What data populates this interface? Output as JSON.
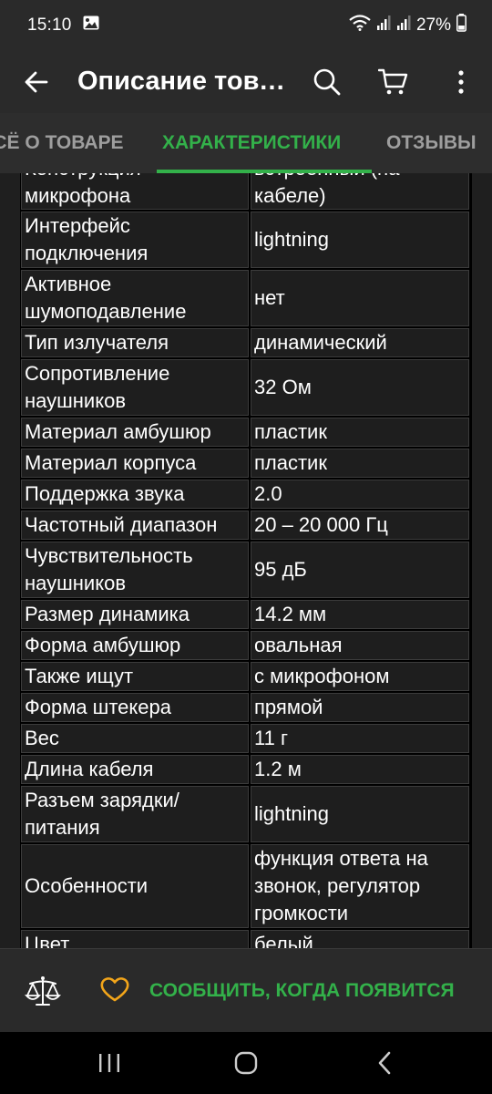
{
  "status_bar": {
    "time": "15:10",
    "battery": "27%",
    "icons": [
      "gallery-icon",
      "wifi-icon",
      "signal-icon",
      "signal-icon",
      "battery-icon"
    ]
  },
  "app_bar": {
    "title": "Описание товара",
    "icons": [
      "back-arrow-icon",
      "search-icon",
      "cart-icon",
      "more-vertical-icon"
    ]
  },
  "tabs": [
    {
      "label": "ВСЁ О ТОВАРЕ"
    },
    {
      "label": "ХАРАКТЕРИСТИКИ"
    },
    {
      "label": "ОТЗЫВЫ"
    }
  ],
  "specs": [
    {
      "key": "Конструкция микрофона",
      "value": "встроенный (на кабеле)"
    },
    {
      "key": "Интерфейс подключения",
      "value": "lightning"
    },
    {
      "key": "Активное шумоподавление",
      "value": "нет"
    },
    {
      "key": "Тип излучателя",
      "value": "динамический"
    },
    {
      "key": "Сопротивление наушников",
      "value": "32 Ом"
    },
    {
      "key": "Материал амбушюр",
      "value": "пластик"
    },
    {
      "key": "Материал корпуса",
      "value": "пластик"
    },
    {
      "key": "Поддержка звука",
      "value": "2.0"
    },
    {
      "key": "Частотный диапазон",
      "value": "20 – 20 000 Гц"
    },
    {
      "key": "Чувствительность наушников",
      "value": "95 дБ"
    },
    {
      "key": "Размер динамика",
      "value": "14.2 мм"
    },
    {
      "key": "Форма амбушюр",
      "value": "овальная"
    },
    {
      "key": "Также ищут",
      "value": "с микрофоном"
    },
    {
      "key": "Форма штекера",
      "value": "прямой"
    },
    {
      "key": "Вес",
      "value": "11 г"
    },
    {
      "key": "Длина кабеля",
      "value": "1.2 м"
    },
    {
      "key": "Разъем зарядки/ питания",
      "value": "lightning"
    },
    {
      "key": "Особенности",
      "value": "функция ответа на звонок, регулятор громкости"
    },
    {
      "key": "Цвет",
      "value": "белый"
    }
  ],
  "bottom_bar": {
    "notify_label": "СООБЩИТЬ, КОГДА ПОЯВИТСЯ",
    "icons": [
      "compare-scales-icon",
      "heart-icon"
    ]
  },
  "nav_bar": {
    "icons": [
      "recent-apps-icon",
      "home-icon",
      "back-icon"
    ]
  },
  "colors": {
    "accent": "#33b14a",
    "heart": "#f2a51a",
    "background": "#1f1f1f",
    "bars": "#2a2a2a",
    "cell_border": "#3c3c3c"
  }
}
